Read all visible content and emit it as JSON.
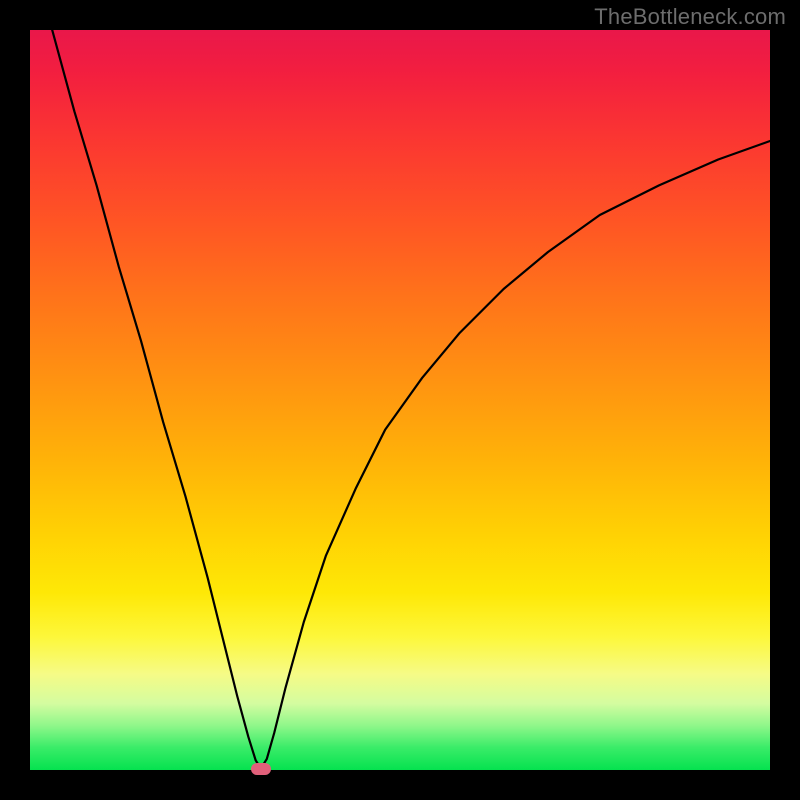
{
  "watermark": "TheBottleneck.com",
  "chart_data": {
    "type": "line",
    "title": "",
    "xlabel": "",
    "ylabel": "",
    "xlim": [
      0,
      100
    ],
    "ylim": [
      0,
      100
    ],
    "grid": false,
    "legend": false,
    "background_gradient": {
      "direction": "vertical",
      "stops": [
        {
          "pos": 0,
          "color": "#e9174a"
        },
        {
          "pos": 15,
          "color": "#fb3731"
        },
        {
          "pos": 36,
          "color": "#ff731a"
        },
        {
          "pos": 58,
          "color": "#ffb208"
        },
        {
          "pos": 76,
          "color": "#fee806"
        },
        {
          "pos": 87,
          "color": "#f6fb86"
        },
        {
          "pos": 94,
          "color": "#8ff78a"
        },
        {
          "pos": 100,
          "color": "#05e24f"
        }
      ]
    },
    "series": [
      {
        "name": "bottleneck-curve",
        "color": "#000000",
        "x": [
          3,
          6,
          9,
          12,
          15,
          18,
          21,
          24,
          26,
          28,
          29.5,
          30.5,
          31.2,
          32,
          33,
          34.5,
          37,
          40,
          44,
          48,
          53,
          58,
          64,
          70,
          77,
          85,
          93,
          100
        ],
        "y": [
          100,
          89,
          79,
          68,
          58,
          47,
          37,
          26,
          18,
          10,
          4.5,
          1.3,
          0.2,
          1.5,
          5,
          11,
          20,
          29,
          38,
          46,
          53,
          59,
          65,
          70,
          75,
          79,
          82.5,
          85
        ]
      }
    ],
    "marker": {
      "x": 31.2,
      "y": 0.2,
      "color": "#e1607a",
      "shape": "pill"
    }
  }
}
